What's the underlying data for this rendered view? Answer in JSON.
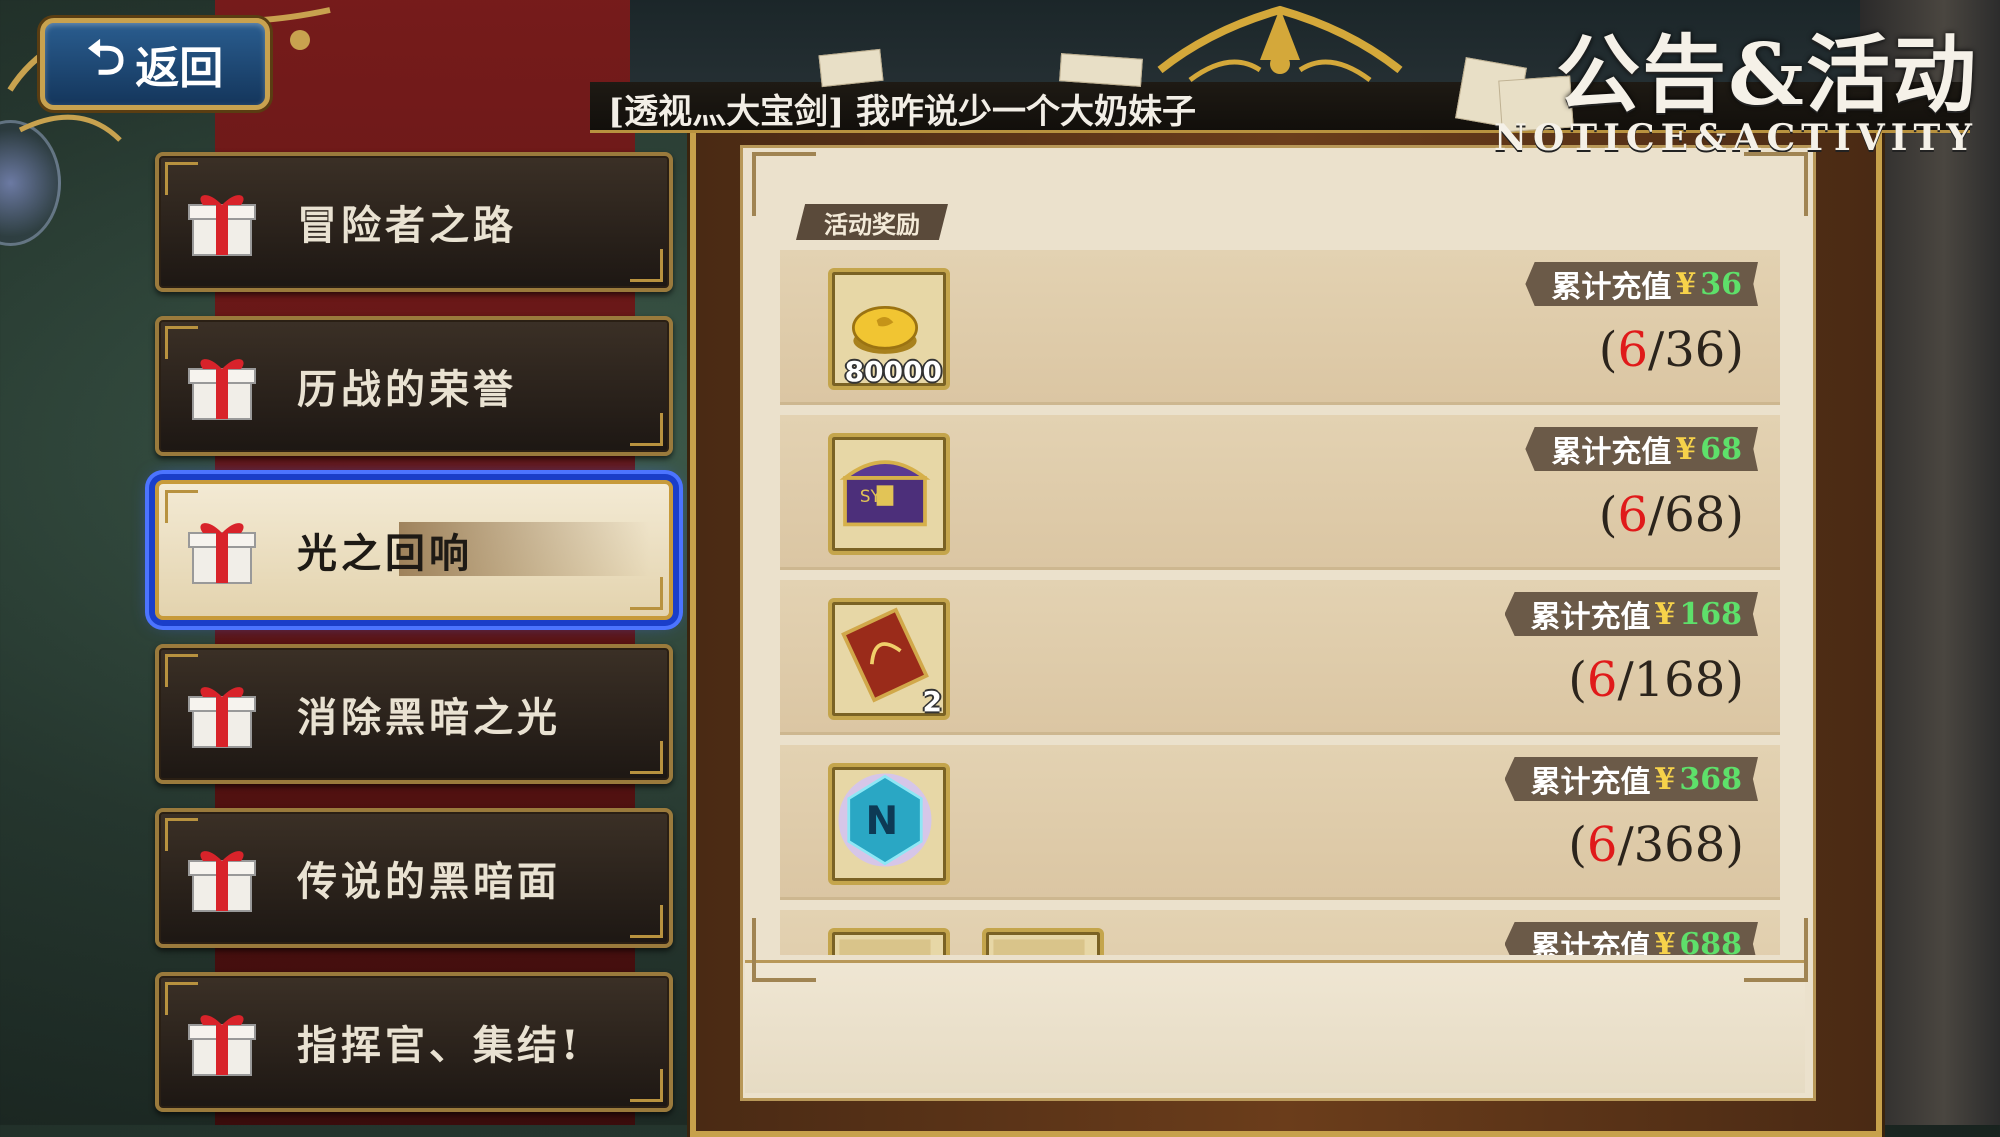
{
  "nav": {
    "back_label": "返回"
  },
  "header": {
    "title_cn": "公告&活动",
    "title_en": "NOTICE&ACTIVITY",
    "banner_text": "[透视灬大宝剑] 我咋说少一个大奶妹子"
  },
  "menu": {
    "items": [
      {
        "label": "冒险者之路",
        "active": false
      },
      {
        "label": "历战的荣誉",
        "active": false
      },
      {
        "label": "光之回响",
        "active": true
      },
      {
        "label": "消除黑暗之光",
        "active": false
      },
      {
        "label": "传说的黑暗面",
        "active": false
      },
      {
        "label": "指挥官、集结!",
        "active": false
      }
    ]
  },
  "content": {
    "section_tag": "活动奖励",
    "rewards": [
      {
        "label": "累计充值",
        "currency": "¥",
        "amount": "36",
        "progress_current": "6",
        "progress_total": "36",
        "item_icon": "gold-coin-icon",
        "item_qty": "80000"
      },
      {
        "label": "累计充值",
        "currency": "¥",
        "amount": "68",
        "progress_current": "6",
        "progress_total": "68",
        "item_icon": "treasure-chest-icon",
        "item_qty": ""
      },
      {
        "label": "累计充值",
        "currency": "¥",
        "amount": "168",
        "progress_current": "6",
        "progress_total": "168",
        "item_icon": "ticket-icon",
        "item_qty": "2"
      },
      {
        "label": "累计充值",
        "currency": "¥",
        "amount": "368",
        "progress_current": "6",
        "progress_total": "368",
        "item_icon": "blue-crystal-icon",
        "item_qty": ""
      },
      {
        "label": "累计充值",
        "currency": "¥",
        "amount": "688",
        "progress_current": "",
        "progress_total": "",
        "item_icon": "partial-item-icon",
        "item_qty": ""
      }
    ]
  },
  "colors": {
    "progress_current": "#e01a1a",
    "amount_green": "#5ee06a",
    "yen_yellow": "#f6d24a",
    "active_highlight": "#1a3ec9"
  }
}
